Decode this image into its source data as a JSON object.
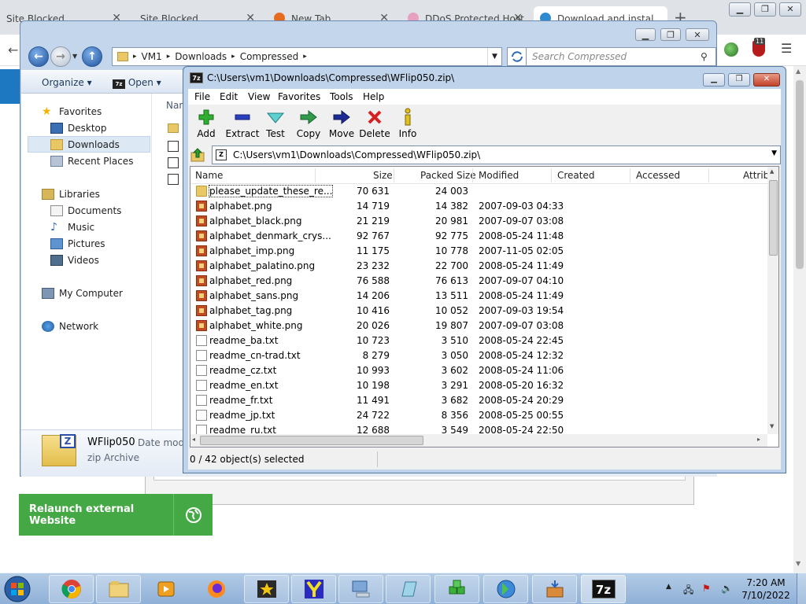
{
  "browser": {
    "tabs": [
      {
        "label": "Site Blocked"
      },
      {
        "label": "Site Blocked"
      },
      {
        "label": "New Tab"
      },
      {
        "label": "DDoS Protected Host"
      },
      {
        "label": "Download and instal"
      }
    ],
    "ext_badge": "11",
    "relaunch_label": "Relaunch external Website"
  },
  "explorer": {
    "breadcrumb": [
      "VM1",
      "Downloads",
      "Compressed"
    ],
    "search_placeholder": "Search Compressed",
    "commands": {
      "organize": "Organize",
      "open": "Open"
    },
    "nav": {
      "favorites": "Favorites",
      "desktop": "Desktop",
      "downloads": "Downloads",
      "recent_places": "Recent Places",
      "libraries": "Libraries",
      "documents": "Documents",
      "music": "Music",
      "pictures": "Pictures",
      "videos": "Videos",
      "my_computer": "My Computer",
      "network": "Network"
    },
    "content_header": "Nan",
    "details": {
      "name": "WFlip050",
      "type": "zip Archive",
      "date_label": "Date modifi"
    }
  },
  "sevenzip": {
    "title": "C:\\Users\\vm1\\Downloads\\Compressed\\WFlip050.zip\\",
    "menu": [
      "File",
      "Edit",
      "View",
      "Favorites",
      "Tools",
      "Help"
    ],
    "toolbar": {
      "add": "Add",
      "extract": "Extract",
      "test": "Test",
      "copy": "Copy",
      "move": "Move",
      "delete": "Delete",
      "info": "Info"
    },
    "path": "C:\\Users\\vm1\\Downloads\\Compressed\\WFlip050.zip\\",
    "columns": {
      "name": "Name",
      "size": "Size",
      "packed": "Packed Size",
      "modified": "Modified",
      "created": "Created",
      "accessed": "Accessed",
      "attrib": "Attrib"
    },
    "files": [
      {
        "name": "please_update_these_re...",
        "size": "70 631",
        "packed": "24 003",
        "modified": "",
        "type": "folder"
      },
      {
        "name": "alphabet.png",
        "size": "14 719",
        "packed": "14 382",
        "modified": "2007-09-03 04:33",
        "type": "png"
      },
      {
        "name": "alphabet_black.png",
        "size": "21 219",
        "packed": "20 981",
        "modified": "2007-09-07 03:08",
        "type": "png"
      },
      {
        "name": "alphabet_denmark_crys...",
        "size": "92 767",
        "packed": "92 775",
        "modified": "2008-05-24 11:48",
        "type": "png"
      },
      {
        "name": "alphabet_imp.png",
        "size": "11 175",
        "packed": "10 778",
        "modified": "2007-11-05 02:05",
        "type": "png"
      },
      {
        "name": "alphabet_palatino.png",
        "size": "23 232",
        "packed": "22 700",
        "modified": "2008-05-24 11:49",
        "type": "png"
      },
      {
        "name": "alphabet_red.png",
        "size": "76 588",
        "packed": "76 613",
        "modified": "2007-09-07 04:10",
        "type": "png"
      },
      {
        "name": "alphabet_sans.png",
        "size": "14 206",
        "packed": "13 511",
        "modified": "2008-05-24 11:49",
        "type": "png"
      },
      {
        "name": "alphabet_tag.png",
        "size": "10 416",
        "packed": "10 052",
        "modified": "2007-09-03 19:54",
        "type": "png"
      },
      {
        "name": "alphabet_white.png",
        "size": "20 026",
        "packed": "19 807",
        "modified": "2007-09-07 03:08",
        "type": "png"
      },
      {
        "name": "readme_ba.txt",
        "size": "10 723",
        "packed": "3 510",
        "modified": "2008-05-24 22:45",
        "type": "txt"
      },
      {
        "name": "readme_cn-trad.txt",
        "size": "8 279",
        "packed": "3 050",
        "modified": "2008-05-24 12:32",
        "type": "txt"
      },
      {
        "name": "readme_cz.txt",
        "size": "10 993",
        "packed": "3 602",
        "modified": "2008-05-24 11:06",
        "type": "txt"
      },
      {
        "name": "readme_en.txt",
        "size": "10 198",
        "packed": "3 291",
        "modified": "2008-05-20 16:32",
        "type": "txt"
      },
      {
        "name": "readme_fr.txt",
        "size": "11 491",
        "packed": "3 682",
        "modified": "2008-05-24 20:29",
        "type": "txt"
      },
      {
        "name": "readme_jp.txt",
        "size": "24 722",
        "packed": "8 356",
        "modified": "2008-05-25 00:55",
        "type": "txt"
      },
      {
        "name": "readme_ru.txt",
        "size": "12 688",
        "packed": "3 549",
        "modified": "2008-05-24 22:50",
        "type": "txt"
      }
    ],
    "status": "0 / 42 object(s) selected"
  },
  "taskbar": {
    "time": "7:20 AM",
    "date": "7/10/2022",
    "sevenzip_label": "7z"
  }
}
